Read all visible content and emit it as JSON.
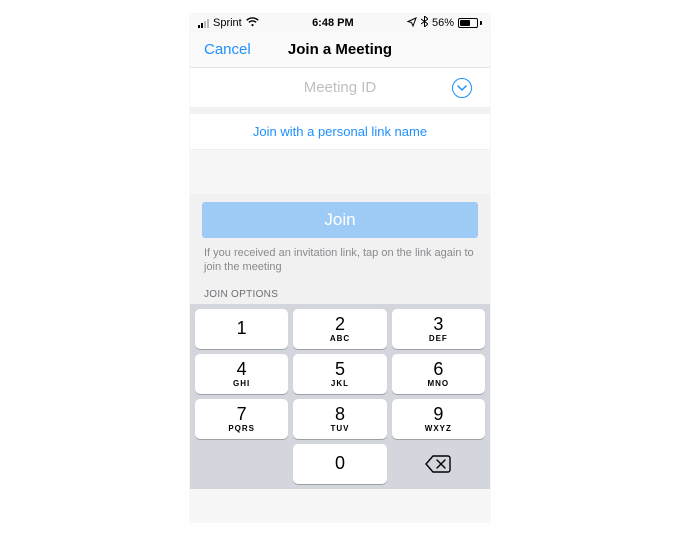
{
  "statusbar": {
    "carrier": "Sprint",
    "time": "6:48 PM",
    "battery_pct": "56%"
  },
  "nav": {
    "cancel": "Cancel",
    "title": "Join a Meeting"
  },
  "meeting_input": {
    "placeholder": "Meeting ID"
  },
  "personal_link": "Join with a personal link name",
  "join_button": "Join",
  "hint": "If you received an invitation link, tap on the link again to join the meeting",
  "options_label": "JOIN OPTIONS",
  "keypad": {
    "k1": {
      "digit": "1",
      "letters": ""
    },
    "k2": {
      "digit": "2",
      "letters": "ABC"
    },
    "k3": {
      "digit": "3",
      "letters": "DEF"
    },
    "k4": {
      "digit": "4",
      "letters": "GHI"
    },
    "k5": {
      "digit": "5",
      "letters": "JKL"
    },
    "k6": {
      "digit": "6",
      "letters": "MNO"
    },
    "k7": {
      "digit": "7",
      "letters": "PQRS"
    },
    "k8": {
      "digit": "8",
      "letters": "TUV"
    },
    "k9": {
      "digit": "9",
      "letters": "WXYZ"
    },
    "k0": {
      "digit": "0",
      "letters": ""
    }
  }
}
